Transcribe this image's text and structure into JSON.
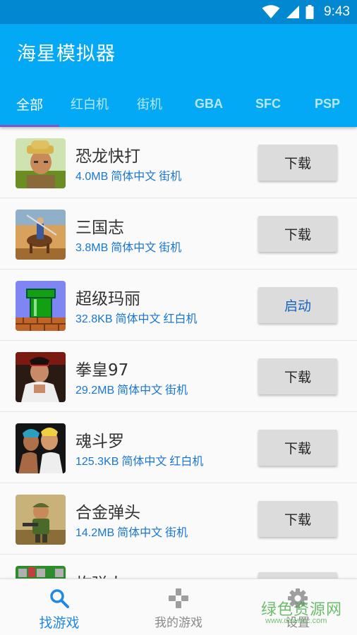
{
  "status_bar": {
    "time": "9:43",
    "icons": [
      "wifi-icon",
      "signal-icon",
      "battery-icon"
    ]
  },
  "app_bar": {
    "title": "海星模拟器",
    "tabs": [
      {
        "label": "全部",
        "active": true
      },
      {
        "label": "红白机",
        "active": false
      },
      {
        "label": "街机",
        "active": false
      },
      {
        "label": "GBA",
        "active": false
      },
      {
        "label": "SFC",
        "active": false
      },
      {
        "label": "PSP",
        "active": false
      }
    ]
  },
  "games": [
    {
      "name": "恐龙快打",
      "size": "4.0MB",
      "lang": "简体中文",
      "category": "街机",
      "action": "下载",
      "thumb": "cadillacs-dinosaurs-thumbnail"
    },
    {
      "name": "三国志",
      "size": "3.8MB",
      "lang": "简体中文",
      "category": "街机",
      "action": "下载",
      "thumb": "sangokushi-thumbnail"
    },
    {
      "name": "超级玛丽",
      "size": "32.8KB",
      "lang": "简体中文",
      "category": "红白机",
      "action": "启动",
      "thumb": "super-mario-thumbnail"
    },
    {
      "name": "拳皇97",
      "size": "29.2MB",
      "lang": "简体中文",
      "category": "街机",
      "action": "下载",
      "thumb": "kof97-thumbnail"
    },
    {
      "name": "魂斗罗",
      "size": "125.3KB",
      "lang": "简体中文",
      "category": "红白机",
      "action": "下载",
      "thumb": "contra-thumbnail"
    },
    {
      "name": "合金弹头",
      "size": "14.2MB",
      "lang": "简体中文",
      "category": "街机",
      "action": "下载",
      "thumb": "metal-slug-thumbnail"
    },
    {
      "name": "炸弹人",
      "size": "",
      "lang": "",
      "category": "",
      "action": "",
      "thumb": "bomberman-thumbnail"
    }
  ],
  "bottom_nav": [
    {
      "label": "找游戏",
      "icon": "search-icon",
      "active": true
    },
    {
      "label": "我的游戏",
      "icon": "gamepad-icon",
      "active": false
    },
    {
      "label": "设置",
      "icon": "gear-icon",
      "active": false
    }
  ],
  "watermark": {
    "text": "绿色资源网",
    "url": "www.downcc.com"
  },
  "colors": {
    "primary": "#03a9f4",
    "status_bar": "#0288d1",
    "tab_indicator": "#7e57c2",
    "meta_text": "#1976d2",
    "nav_active": "#1e88e5"
  }
}
